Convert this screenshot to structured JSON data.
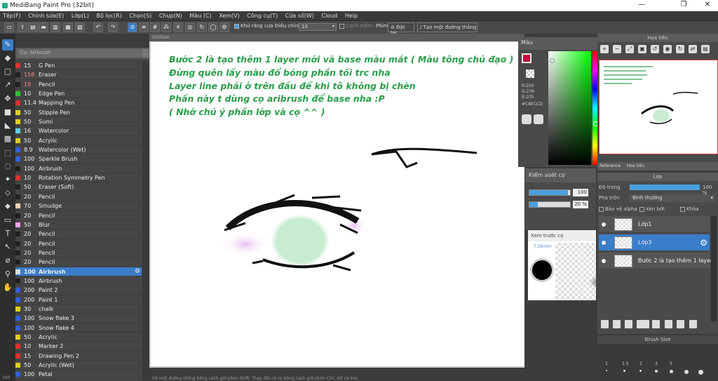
{
  "window": {
    "title": "MediBang Paint Pro (32bit)",
    "min": "—",
    "max": "❐",
    "close": "✕"
  },
  "menu": [
    "Tệp(F)",
    "Chỉnh sửa(E)",
    "Lớp(L)",
    "Bộ lọc(R)",
    "Chọn(S)",
    "Chụp(N)",
    "Màu (C)",
    "Xem(V)",
    "Công cụ(T)",
    "Cửa sổ(W)",
    "Cloud",
    "Help"
  ],
  "toolbar": {
    "antialias": "Khử răng cưa",
    "adjust_label": "Điều chỉnh",
    "adjust_value": "10",
    "correction": "Canh mềm",
    "key_label": "Phím",
    "reset": "Đặt lại",
    "create_line": "Tạo một đường thẳng"
  },
  "canvas_tab": "Untitled",
  "brush_panel": {
    "search_placeholder": "Cọ: Airbrush",
    "brushes": [
      {
        "size": "15",
        "name": "G Pen",
        "color": "#e03030"
      },
      {
        "size": "158",
        "name": "Eraser",
        "color": "#202020"
      },
      {
        "size": "18",
        "name": "Pencil",
        "color": "#202020"
      },
      {
        "size": "10",
        "name": "Edge Pen",
        "color": "#30c030"
      },
      {
        "size": "11.4",
        "name": "Mapping Pen",
        "color": "#e03030"
      },
      {
        "size": "50",
        "name": "Stipple Pen",
        "color": "#e0d020"
      },
      {
        "size": "50",
        "name": "Sumi",
        "color": "#e0d020"
      },
      {
        "size": "16",
        "name": "Watercolor",
        "color": "#60d0f0"
      },
      {
        "size": "50",
        "name": "Acrylic",
        "color": "#e0d020"
      },
      {
        "size": "8.9",
        "name": "Watercolor (Wet)",
        "color": "#3060e0"
      },
      {
        "size": "100",
        "name": "Sparkle Brush",
        "color": "#3060e0"
      },
      {
        "size": "100",
        "name": "Airbrush",
        "color": "#202020"
      },
      {
        "size": "10",
        "name": "Rotation Symmetry Pen",
        "color": "#e03030"
      },
      {
        "size": "50",
        "name": "Eraser (Soft)",
        "color": "#202020"
      },
      {
        "size": "20",
        "name": "Pencil",
        "color": "#202020"
      },
      {
        "size": "70",
        "name": "Smudge",
        "color": "#f0d0b0"
      },
      {
        "size": "20",
        "name": "Pencil",
        "color": "#202020"
      },
      {
        "size": "50",
        "name": "Blur",
        "color": "#f0a0f0"
      },
      {
        "size": "20",
        "name": "Pencil",
        "color": "#202020"
      },
      {
        "size": "20",
        "name": "Pencil",
        "color": "#202020"
      },
      {
        "size": "20",
        "name": "Pencil",
        "color": "#202020"
      },
      {
        "size": "20",
        "name": "Pencil",
        "color": "#202020"
      },
      {
        "size": "100",
        "name": "Airbrush",
        "color": "#dddddd",
        "selected": true
      },
      {
        "size": "100",
        "name": "Airbrush",
        "color": "#202020"
      },
      {
        "size": "200",
        "name": "Paint 2",
        "color": "#3060e0"
      },
      {
        "size": "200",
        "name": "Paint 1",
        "color": "#3060e0"
      },
      {
        "size": "30",
        "name": "chalk",
        "color": "#e0d020"
      },
      {
        "size": "100",
        "name": "Snow flake 3",
        "color": "#3060e0"
      },
      {
        "size": "100",
        "name": "Snow flake 4",
        "color": "#3060e0"
      },
      {
        "size": "50",
        "name": "Acrylic",
        "color": "#e0d020"
      },
      {
        "size": "10",
        "name": "Marker 2",
        "color": "#e03030"
      },
      {
        "size": "15",
        "name": "Drawing Pen 2",
        "color": "#e03030"
      },
      {
        "size": "50",
        "name": "Acrylic (Wet)",
        "color": "#e0d020"
      },
      {
        "size": "100",
        "name": "Petal",
        "color": "#3060e0"
      }
    ]
  },
  "canvas_notes": [
    "Bước 2 là tạo thêm 1 layer mới và base màu mắt ( Màu tông chủ đạo )",
    "Đừng quên lấy màu đổ bóng phần tối trc nha",
    "Layer line phải ở trên đầu để khi tô không bị chèn",
    "Phần này t dùng cọ aribrush để base nha :P",
    "( Nhớ chú ý phần lớp và cọ ^^ )"
  ],
  "status_text": "Vẽ một đường thẳng bằng cách giữ phím Shift. Thay đổi cỡ cọ bằng cách giữ phím Ctrl, Alt và kéo.",
  "status_left": "160",
  "color_panel": {
    "title": "Màu",
    "r": "R:200",
    "g": "G:236",
    "b": "B:205",
    "hex": "#C8ECCD",
    "main_color": "#c8063a"
  },
  "brush_control": {
    "title": "Kiểm soát cọ",
    "size": "100",
    "opacity": "20 %",
    "size_fill": 0.95,
    "opacity_fill": 0.2
  },
  "brush_preview": {
    "title": "Xem trước cọ",
    "size": "7.26mm"
  },
  "navigator": {
    "title": "Hoa tiêu"
  },
  "nav_tabs": [
    "Reference",
    "Hoa tiêu"
  ],
  "layer_panel": {
    "title": "Lớp",
    "opacity_label": "Độ trong",
    "opacity_value": "100 %",
    "blend_label": "Pha trộn",
    "blend_value": "Bình thường",
    "protect_alpha": "Bảo vệ alpha",
    "clipping": "Xén bớt",
    "lock": "Khóa",
    "layers": [
      {
        "name": "Lớp1",
        "selected": false
      },
      {
        "name": "Lớp3",
        "selected": true
      },
      {
        "name": "Bước 2 là tạo thêm 1 layer",
        "selected": false
      }
    ]
  },
  "brush_size_panel": {
    "title": "Brush Size",
    "sizes": [
      "1",
      "1.5",
      "2",
      "3",
      "5"
    ]
  }
}
